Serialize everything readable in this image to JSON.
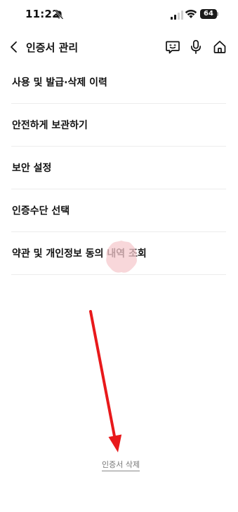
{
  "status_bar": {
    "time": "11:22",
    "battery_level": "64",
    "icons": [
      "bell-slash-icon",
      "signal-icon",
      "wifi-icon",
      "battery-icon"
    ]
  },
  "header": {
    "title": "인증서 관리",
    "back_icon": "chevron-left-icon",
    "actions": [
      "chat-icon",
      "microphone-icon",
      "home-icon"
    ]
  },
  "menu": {
    "items": [
      {
        "label": "사용 및 발급·삭제 이력"
      },
      {
        "label": "안전하게 보관하기"
      },
      {
        "label": "보안 설정"
      },
      {
        "label": "인증수단 선택"
      },
      {
        "label": "약관 및 개인정보 동의 내역 조회"
      }
    ]
  },
  "footer": {
    "delete_link": "인증서 삭제"
  },
  "colors": {
    "text": "#111111",
    "divider": "#ececec",
    "annotation_arrow": "#e8191b",
    "touch_highlight": "#f6c9cd",
    "link_text": "#777777"
  }
}
